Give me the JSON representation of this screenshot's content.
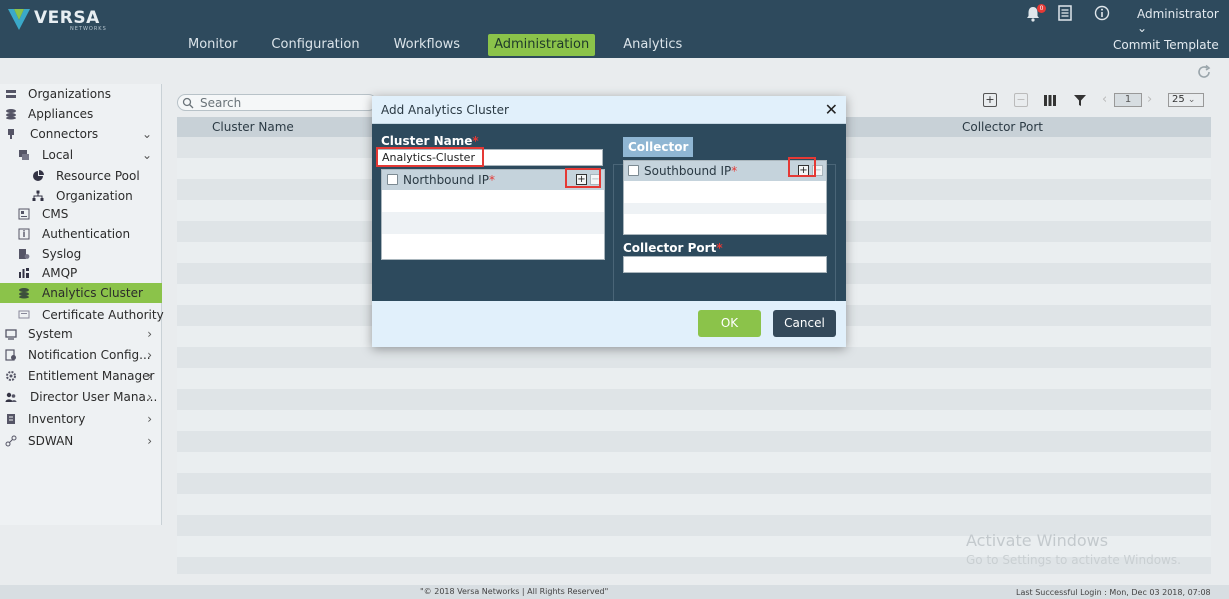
{
  "header": {
    "logo_text": "VERSA",
    "logo_sub": "NETWORKS",
    "nav": [
      "Monitor",
      "Configuration",
      "Workflows",
      "Administration",
      "Analytics"
    ],
    "active_nav": "Administration",
    "notification_count": "0",
    "user": "Administrator",
    "commit": "Commit Template"
  },
  "sidebar": {
    "items": [
      {
        "label": "Organizations"
      },
      {
        "label": "Appliances"
      },
      {
        "label": "Connectors"
      },
      {
        "label": "Local"
      },
      {
        "label": "Resource Pool"
      },
      {
        "label": "Organization"
      },
      {
        "label": "CMS"
      },
      {
        "label": "Authentication"
      },
      {
        "label": "Syslog"
      },
      {
        "label": "AMQP"
      },
      {
        "label": "Analytics Cluster"
      },
      {
        "label": "Certificate Authority"
      },
      {
        "label": "System"
      },
      {
        "label": "Notification Config..."
      },
      {
        "label": "Entitlement Manager"
      },
      {
        "label": "Director User Mana..."
      },
      {
        "label": "Inventory"
      },
      {
        "label": "SDWAN"
      }
    ]
  },
  "grid": {
    "search_placeholder": "Search",
    "columns": [
      "Cluster Name",
      "Collector Port"
    ],
    "page": "1",
    "per_page": "25"
  },
  "modal": {
    "title": "Add Analytics Cluster",
    "cluster_name_label": "Cluster Name",
    "cluster_name_value": "Analytics-Cluster",
    "northbound_label": "Northbound IP",
    "collector_tab": "Collector",
    "southbound_label": "Southbound IP",
    "collector_port_label": "Collector Port",
    "collector_port_value": "",
    "ok": "OK",
    "cancel": "Cancel",
    "required_mark": "*"
  },
  "watermark": {
    "line1": "Activate Windows",
    "line2": "Go to Settings to activate Windows."
  },
  "footer": {
    "copyright": "\"© 2018 Versa Networks | All Rights Reserved\"",
    "last_login": "Last Successful Login : Mon, Dec 03 2018, 07:08"
  },
  "colors": {
    "header_bg": "#2e4a5d",
    "accent": "#8bc34a",
    "modal_body": "#2d4a5d",
    "highlight": "#e53935"
  }
}
